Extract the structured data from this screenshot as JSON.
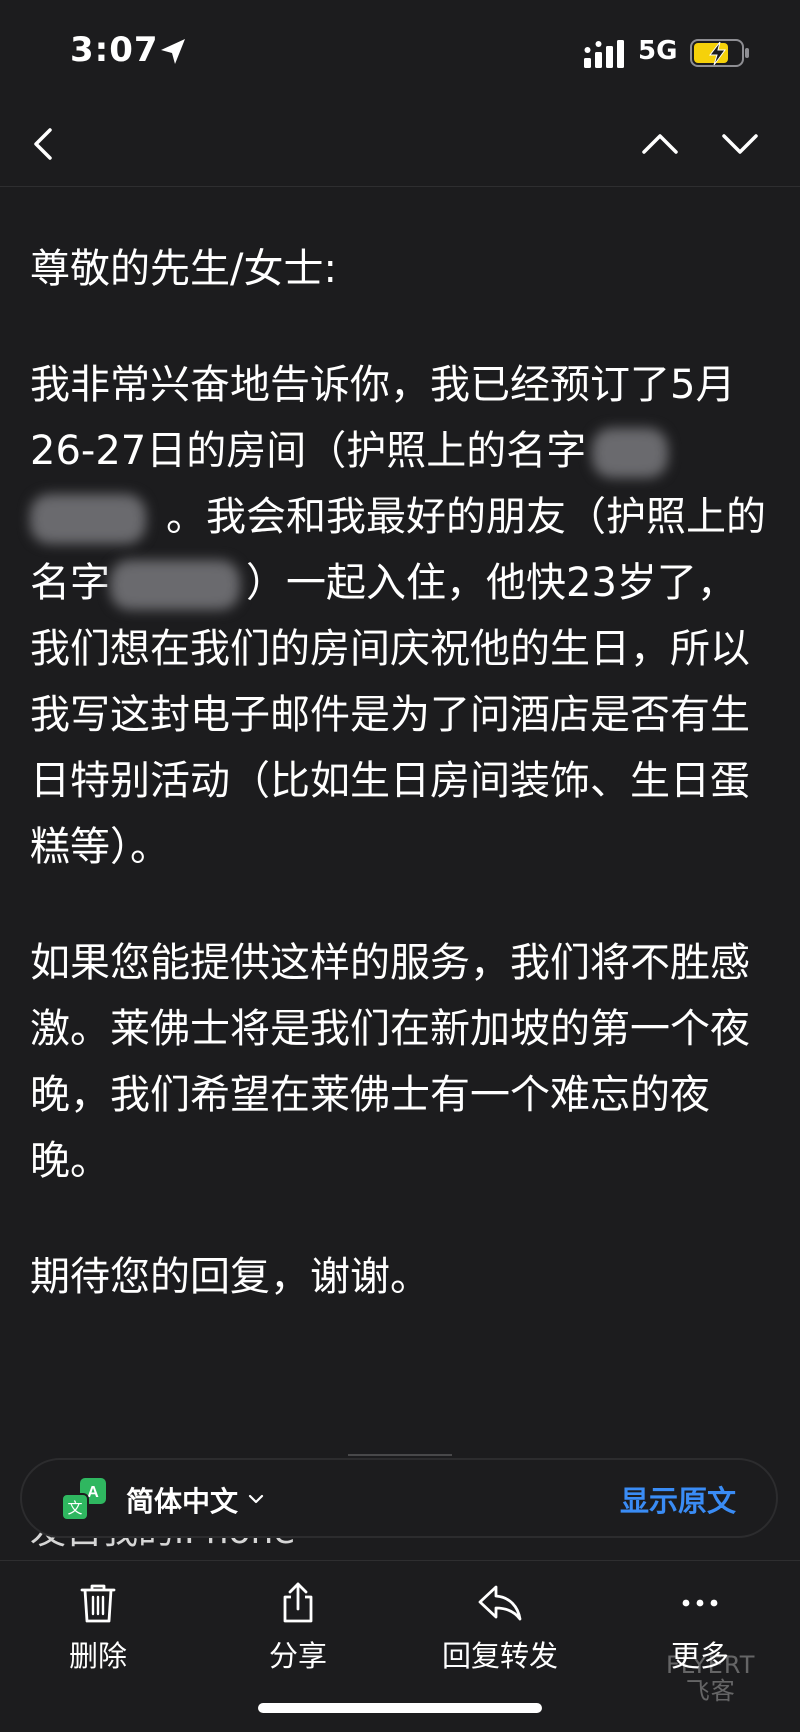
{
  "status_bar": {
    "time": "3:07",
    "network": "5G"
  },
  "email": {
    "greeting": "尊敬的先生/女士:",
    "p1_a": "我非常兴奋地告诉你，我已经预订了5月26-27日的房间（护照上的名字",
    "p1_b": "。我会和我最好的朋友（护照上的名字",
    "p1_c": "）一起入住，他快23岁了，我们想在我们的房间庆祝他的生日，所以我写这封电子邮件是为了问酒店是否有生日特别活动（比如生日房间装饰、生日蛋糕等）。",
    "p2": "如果您能提供这样的服务，我们将不胜感激。莱佛士将是我们在新加坡的第一个夜晚，我们希望在莱佛士有一个难忘的夜晚。",
    "p3": "期待您的回复，谢谢。",
    "partial_line": "发自我的iPhone"
  },
  "translation_bar": {
    "language": "简体中文",
    "show_original": "显示原文"
  },
  "toolbar": {
    "delete": "删除",
    "share": "分享",
    "reply_forward": "回复转发",
    "more": "更多"
  },
  "watermark": {
    "line1": "FLYERT",
    "line2": "飞客"
  },
  "colors": {
    "background": "#1c1c1e",
    "accent": "#3a8cf5",
    "battery": "#f5d10a",
    "translate_icon": "#2fb760"
  }
}
